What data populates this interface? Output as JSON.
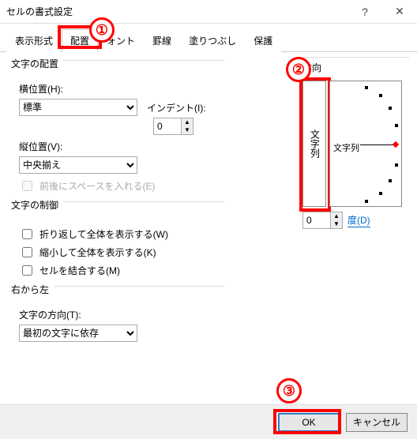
{
  "title": "セルの書式設定",
  "tabs": [
    "表示形式",
    "配置",
    "   ォント",
    "罫線",
    "塗りつぶし",
    "保護"
  ],
  "activeTab": 1,
  "layout": {
    "title": "文字の配置",
    "h_label": "横位置(H):",
    "h_value": "標準",
    "indent_label": "インデント(I):",
    "indent_value": "0",
    "v_label": "縦位置(V):",
    "v_value": "中央揃え",
    "distribute": "前後にスペースを入れる(E)"
  },
  "control": {
    "title": "文字の制御",
    "wrap": "折り返して全体を表示する(W)",
    "shrink": "縮小して全体を表示する(K)",
    "merge": "セルを結合する(M)"
  },
  "rtl": {
    "title": "右から左",
    "dir_label": "文字の方向(T):",
    "dir_value": "最初の文字に依存"
  },
  "orient": {
    "title": "方向",
    "vert": "文字列",
    "dial": "文字列",
    "deg_value": "0",
    "deg_label": "度(D)"
  },
  "buttons": {
    "ok": "OK",
    "cancel": "キャンセル"
  },
  "callouts": {
    "c1": "①",
    "c2": "②",
    "c3": "③"
  }
}
